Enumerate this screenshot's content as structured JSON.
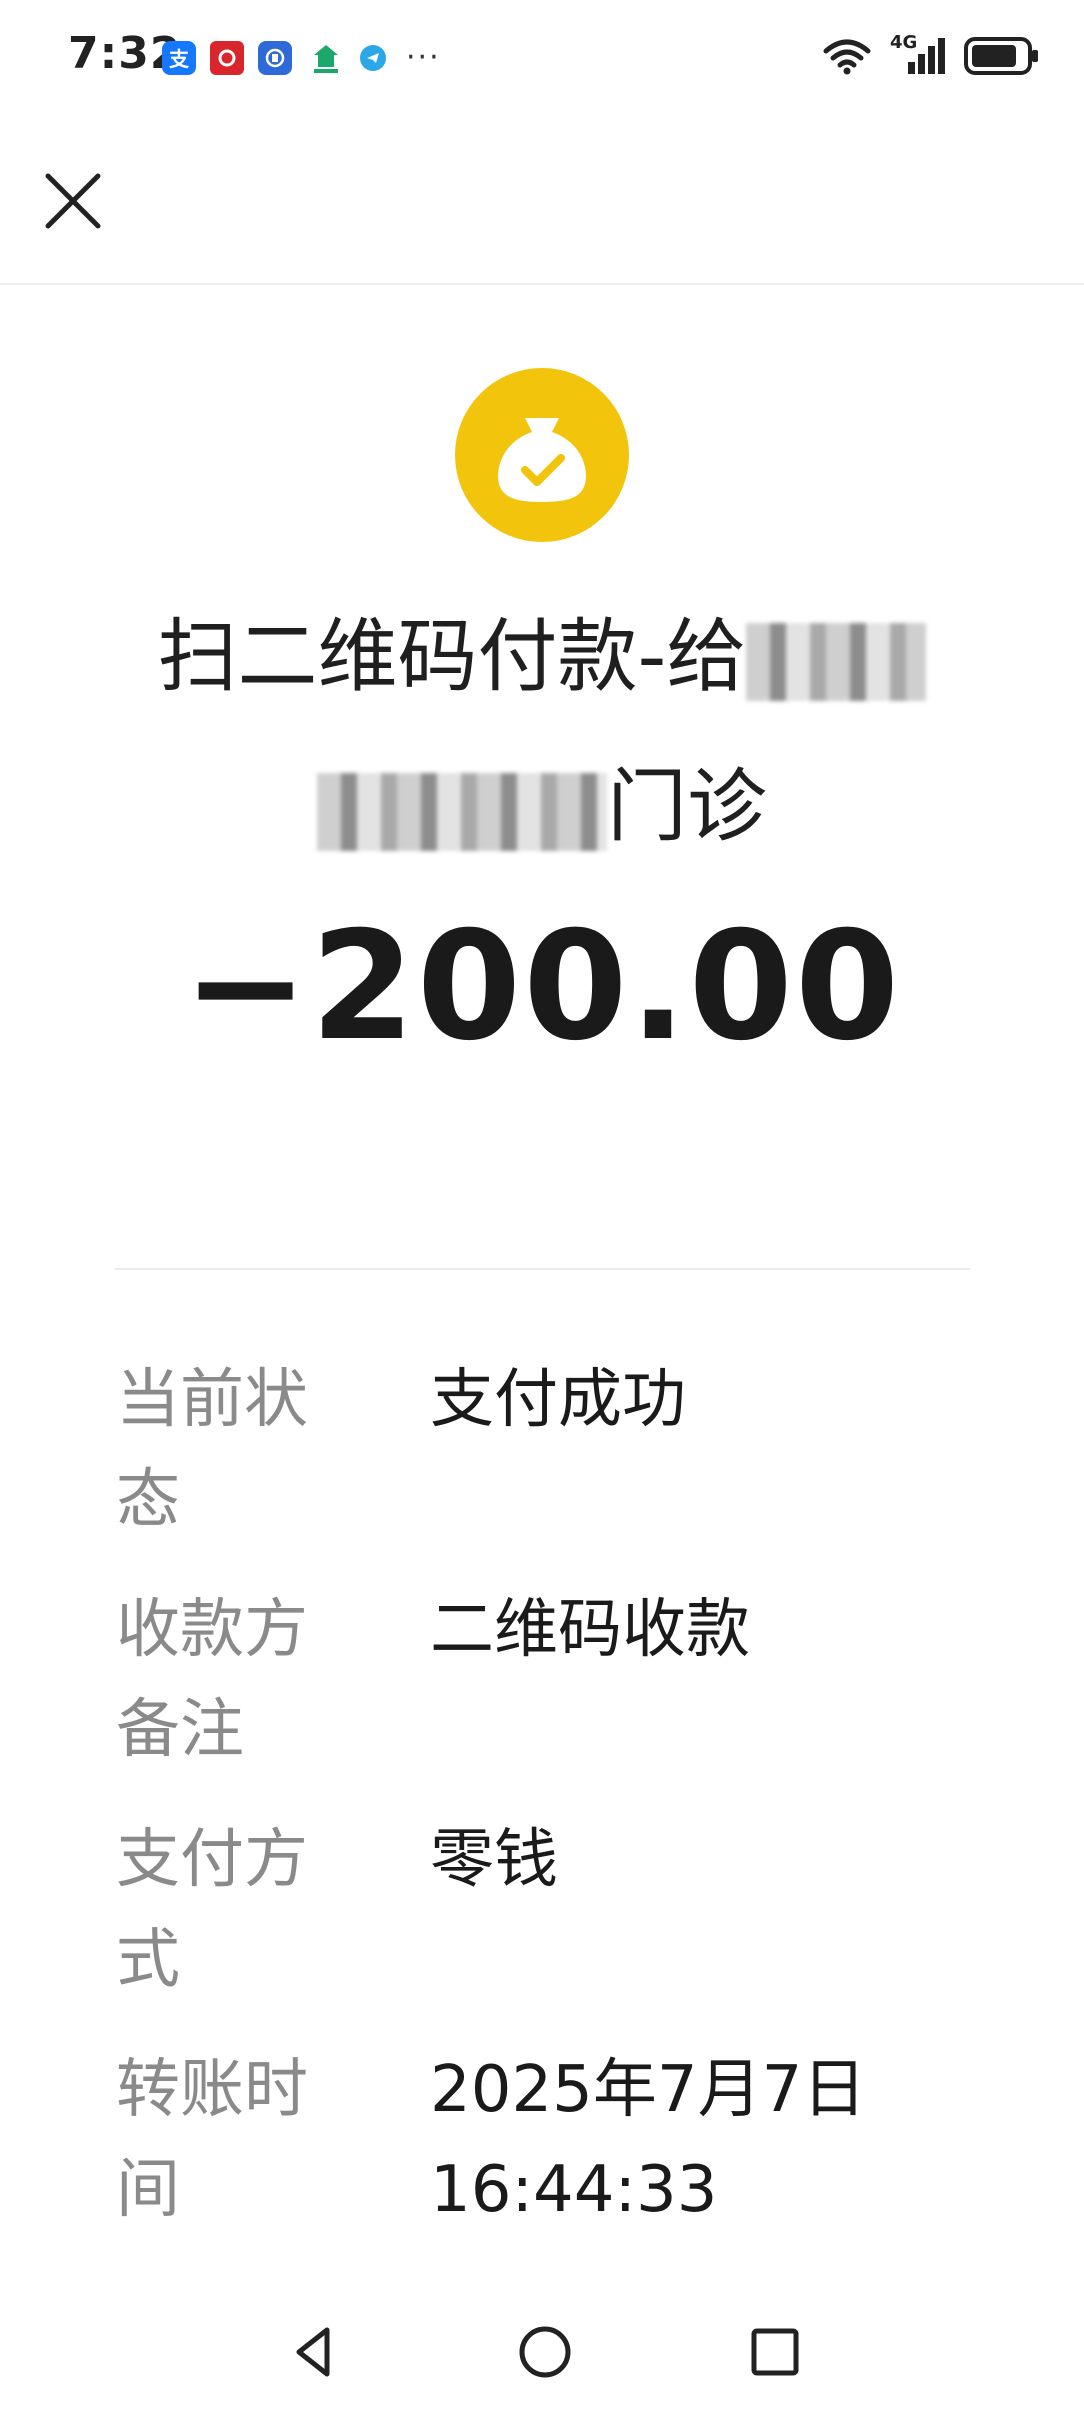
{
  "status_bar": {
    "time": "7:32",
    "notifications": [
      "alipay-icon",
      "bank-app-icon",
      "blue-app-icon",
      "home-app-icon",
      "telegram-icon"
    ],
    "more": "···",
    "network": "4G"
  },
  "header": {
    "logo_icon": "money-bag-check-icon",
    "logo_color": "#f2c40b",
    "title_line1": "扫二维码付款-给",
    "title_line2_suffix": "门诊",
    "amount": "−200.00"
  },
  "details": [
    {
      "label": "当前状态",
      "value": "支付成功"
    },
    {
      "label": "收款方备注",
      "value": "二维码收款"
    },
    {
      "label": "支付方式",
      "value": "零钱"
    },
    {
      "label": "转账时间",
      "value": "2025年7月7日 16:44:33"
    }
  ]
}
